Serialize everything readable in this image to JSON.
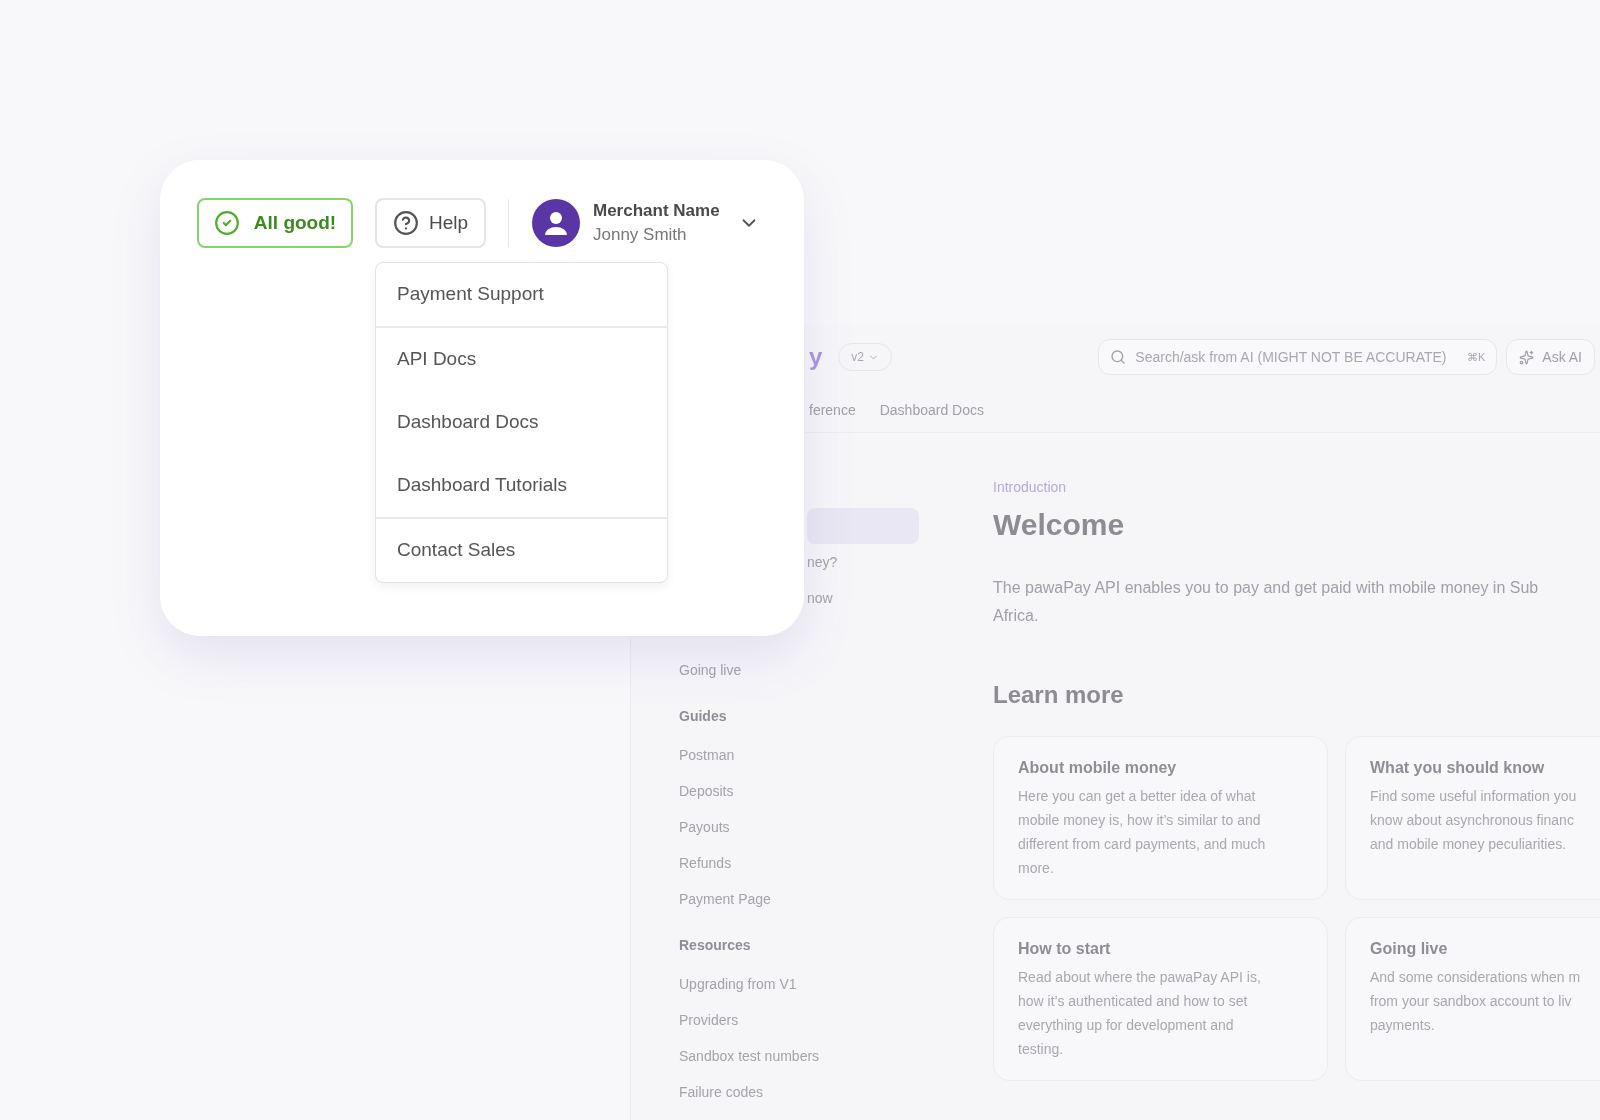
{
  "docs": {
    "logo": "y",
    "version": "v2",
    "search": {
      "placeholder": "Search/ask from AI (MIGHT NOT BE ACCURATE)",
      "shortcut": "⌘K"
    },
    "ask_button": "Ask AI",
    "nav_tabs": [
      {
        "label": "ference"
      },
      {
        "label": "Dashboard Docs"
      }
    ],
    "sidebar": [
      {
        "items": [
          {
            "kind": "clipped",
            "selected": true
          },
          {
            "kind": "clipped",
            "label": "ney?",
            "selected": false
          },
          {
            "kind": "clipped",
            "label": "now",
            "selected": false
          },
          {
            "kind": "spaced",
            "label": "Going live",
            "selected": false
          }
        ]
      },
      {
        "heading": "Guides",
        "items": [
          {
            "label": "Postman",
            "selected": false
          },
          {
            "label": "Deposits",
            "selected": false
          },
          {
            "label": "Payouts",
            "selected": false
          },
          {
            "label": "Refunds",
            "selected": false
          },
          {
            "label": "Payment Page",
            "selected": false
          }
        ]
      },
      {
        "heading": "Resources",
        "items": [
          {
            "label": "Upgrading from V1",
            "selected": false
          },
          {
            "label": "Providers",
            "selected": false
          },
          {
            "label": "Sandbox test numbers",
            "selected": false
          },
          {
            "label": "Failure codes",
            "selected": false
          }
        ]
      }
    ],
    "breadcrumb": "Introduction",
    "title": "Welcome",
    "intro_lines": [
      "The pawaPay API enables you to pay and get paid with mobile money in Sub",
      "Africa."
    ],
    "section_title": "Learn more",
    "cards": [
      {
        "title": "About mobile money",
        "lines": [
          "Here you can get a better idea of what",
          "mobile money is, how it’s similar to and",
          "different from card payments, and much",
          "more."
        ]
      },
      {
        "title": "What you should know",
        "lines": [
          "Find some useful information you",
          "know about asynchronous financ",
          "and mobile money peculiarities."
        ]
      },
      {
        "title": "How to start",
        "lines": [
          "Read about where the pawaPay API is,",
          "how it’s authenticated and how to set",
          "everything up for development and",
          "testing."
        ]
      },
      {
        "title": "Going live",
        "lines": [
          "And some considerations when m",
          "from your sandbox account to liv",
          "payments."
        ]
      }
    ]
  },
  "status_card": {
    "status_button": "All good!",
    "help_button": "Help",
    "account": {
      "name": "Merchant Name",
      "user": "Jonny Smith"
    },
    "help_menu": {
      "groups": [
        [
          "Payment Support"
        ],
        [
          "API Docs",
          "Dashboard Docs",
          "Dashboard Tutorials"
        ],
        [
          "Contact Sales"
        ]
      ]
    }
  }
}
